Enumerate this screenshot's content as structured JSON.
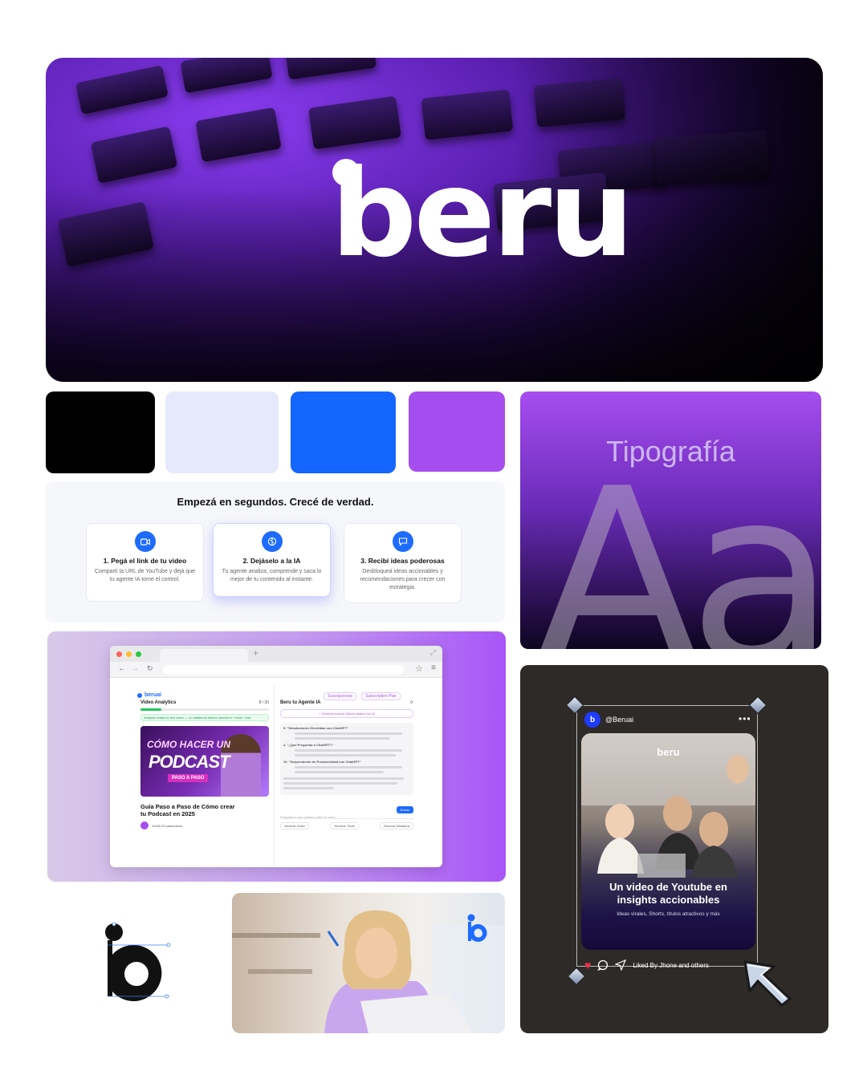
{
  "hero": {
    "logo_text": "beru"
  },
  "palette": {
    "colors": [
      "#000000",
      "#e5e9fb",
      "#1565ff",
      "#a64df0"
    ]
  },
  "steps": {
    "title": "Empezá en segundos. Crecé de verdad.",
    "items": [
      {
        "title": "1. Pegá el link de tu video",
        "desc": "Compartí la URL de YouTube y dejá que tu agente IA tome el control.",
        "icon": "video-icon"
      },
      {
        "title": "2. Dejáselo a la IA",
        "desc": "Tu agente analiza, comprende y saca lo mejor de tu contenido al instante.",
        "icon": "brain-icon"
      },
      {
        "title": "3. Recibí ideas poderosas",
        "desc": "Desbloqueá ideas accionables y recomendaciones para crecer con estrategia.",
        "icon": "chat-icon"
      }
    ]
  },
  "typography": {
    "title": "Tipografía",
    "sample": "Aa"
  },
  "app_mock": {
    "brand": "beruai",
    "nav": [
      "Suscripciones",
      "Subscription Plan"
    ],
    "left": {
      "section": "Video Analytics",
      "counter": "8 / 30",
      "status": "Analysis ready for this video — no additional tokens needed to \"refuel\" chat",
      "thumb_line1": "CÓMO HACER UN",
      "thumb_line2": "PODCAST",
      "thumb_line3": "PASO A PASO",
      "video_title": "Guía Paso a Paso de Cómo crear tu Podcast en 2025",
      "subs": "20400 00 subscribers"
    },
    "right": {
      "title": "Beru tu Agente IA",
      "suggest": "+ Generar nuevos Shorts virales con IA",
      "items": [
        "9. \"Simulaciones Divertidas con ChatGPT\"",
        "4. \"¿Qué Preguntar a ChatGPT?\"",
        "10. \"Sorprendente de Productividad con ChatGPT\""
      ],
      "input_placeholder": "Pregunta lo que quieras sobre tu video...",
      "send": "Enviar",
      "actions": [
        "Generar Guión",
        "Generar Título",
        "Generar Miniatura"
      ]
    }
  },
  "social": {
    "handle": "@Beruai",
    "brand": "beru",
    "headline": "Un video de Youtube en insights accionables",
    "sub": "Ideas virales, Shorts, títulos atractivos y más",
    "likes": "Liked By Jhone and others"
  }
}
